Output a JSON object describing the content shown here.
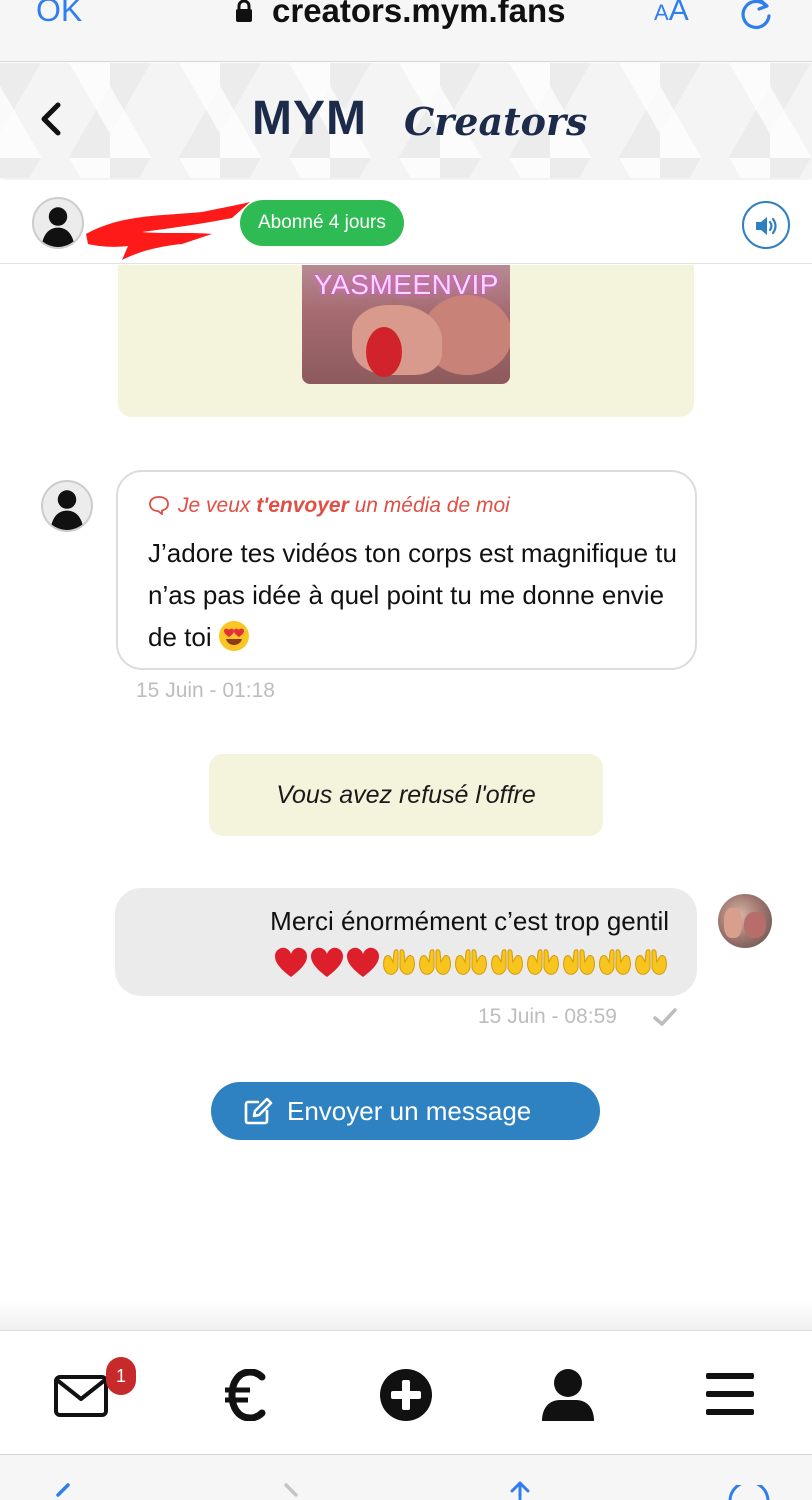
{
  "browser": {
    "done_label": "OK",
    "url": "creators.mym.fans",
    "text_size_small": "A",
    "text_size_big": "A",
    "accent_color": "#2f7ef0"
  },
  "header": {
    "brand_logo": "MYM",
    "brand_subtitle": "Creators"
  },
  "contact": {
    "subscription_badge": "Abonné 4 jours",
    "badge_color": "#2fbb53"
  },
  "media": {
    "watermark": "YASMEENVIP"
  },
  "messages": {
    "incoming": {
      "reply_prefix": "Je veux ",
      "reply_bold": "t'envoyer",
      "reply_suffix": " un média de moi",
      "text": "J’adore tes vidéos ton corps est magnifique tu n’as pas idée à quel point tu me donne envie de toi",
      "emoji": "heart-eyes",
      "time": "15 Juin - 01:18"
    },
    "system_note": "Vous avez refusé l'offre",
    "outgoing": {
      "text": "Merci énormément c’est trop gentil",
      "emoji_hearts": 3,
      "emoji_hands": 8,
      "time": "15 Juin - 08:59"
    }
  },
  "actions": {
    "send_message_label": "Envoyer un message"
  },
  "bottom_nav": {
    "items": [
      {
        "name": "messages",
        "icon": "envelope-icon",
        "badge": "1"
      },
      {
        "name": "earnings",
        "icon": "euro-icon"
      },
      {
        "name": "create",
        "icon": "plus-circle-icon"
      },
      {
        "name": "profile",
        "icon": "user-icon"
      },
      {
        "name": "menu",
        "icon": "hamburger-icon"
      }
    ]
  }
}
